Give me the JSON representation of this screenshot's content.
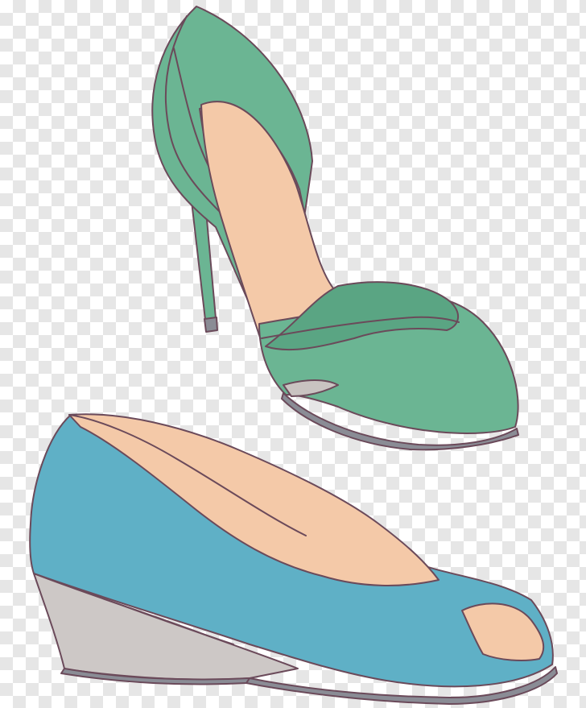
{
  "scene": {
    "background": "transparency-checkerboard",
    "objects": [
      {
        "name": "green-pump-shoe",
        "type": "high-heel d'Orsay pump"
      },
      {
        "name": "blue-wedge-shoe",
        "type": "peep-toe wedge"
      }
    ]
  },
  "colors": {
    "checker_light": "#ffffff",
    "checker_dark": "#e6e6e6",
    "outline": "#6b4a5a",
    "green_upper": "#6bb593",
    "green_shadow": "#5aa583",
    "skin_lining": "#f4c9a8",
    "grey_lining": "#c9c3c1",
    "blue_upper": "#5fb0c6",
    "wedge_grey": "#cdc8c6",
    "sole_dark": "#8a8c95"
  }
}
